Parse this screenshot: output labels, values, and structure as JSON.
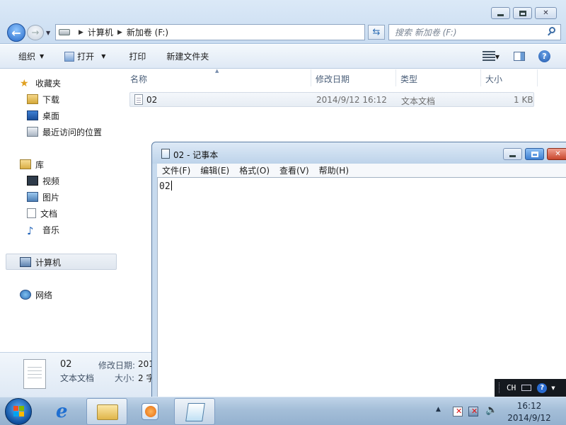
{
  "explorer": {
    "address": {
      "crumbs": [
        "计算机",
        "新加卷 (F:)"
      ]
    },
    "search": {
      "placeholder": "搜索 新加卷 (F:)"
    },
    "toolbar": {
      "organize": "组织",
      "open": "打开",
      "print": "打印",
      "new_folder": "新建文件夹"
    },
    "nav": {
      "favorites": "收藏夹",
      "downloads": "下载",
      "desktop": "桌面",
      "recent": "最近访问的位置",
      "libraries": "库",
      "videos": "视频",
      "pictures": "图片",
      "documents": "文档",
      "music": "音乐",
      "computer": "计算机",
      "network": "网络"
    },
    "columns": {
      "name": "名称",
      "modified": "修改日期",
      "type": "类型",
      "size": "大小"
    },
    "files": [
      {
        "name": "02",
        "modified": "2014/9/12 16:12",
        "type": "文本文档",
        "size": "1 KB"
      }
    ],
    "details": {
      "name": "02",
      "type": "文本文档",
      "modified_label": "修改日期:",
      "modified_value": "201",
      "size_label": "大小:",
      "size_value": "2 字"
    }
  },
  "notepad": {
    "title": "02 - 记事本",
    "menu": [
      "文件(F)",
      "编辑(E)",
      "格式(O)",
      "查看(V)",
      "帮助(H)"
    ],
    "content": "02"
  },
  "langbar": {
    "lang": "CH"
  },
  "tray": {
    "time": "16:12",
    "date": "2014/9/12"
  },
  "icons": {
    "back": "arrow-left-icon",
    "forward": "arrow-right-icon",
    "search": "search-icon",
    "help": "help-icon"
  }
}
